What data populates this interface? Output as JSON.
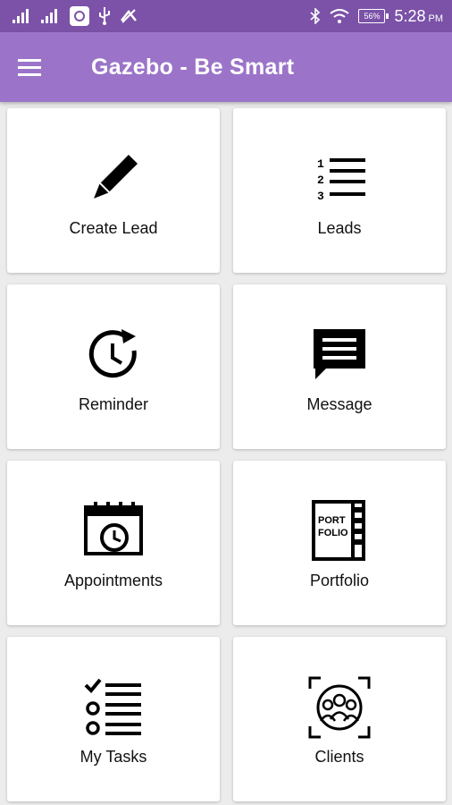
{
  "status_bar": {
    "battery": "56%",
    "time": "5:28",
    "ampm": "PM"
  },
  "app_bar": {
    "title": "Gazebo - Be Smart",
    "menu_icon": "hamburger-menu-icon",
    "color": "#9b74c9"
  },
  "tiles": [
    {
      "label": "Create Lead",
      "icon": "pencil-icon"
    },
    {
      "label": "Leads",
      "icon": "numbered-list-icon"
    },
    {
      "label": "Reminder",
      "icon": "clock-history-icon"
    },
    {
      "label": "Message",
      "icon": "message-bubble-icon"
    },
    {
      "label": "Appointments",
      "icon": "calendar-clock-icon"
    },
    {
      "label": "Portfolio",
      "icon": "portfolio-book-icon"
    },
    {
      "label": "My Tasks",
      "icon": "checklist-icon"
    },
    {
      "label": "Clients",
      "icon": "clients-group-icon"
    }
  ],
  "portfolio_icon_text": {
    "line1": "PORT",
    "line2": "FOLIO"
  }
}
